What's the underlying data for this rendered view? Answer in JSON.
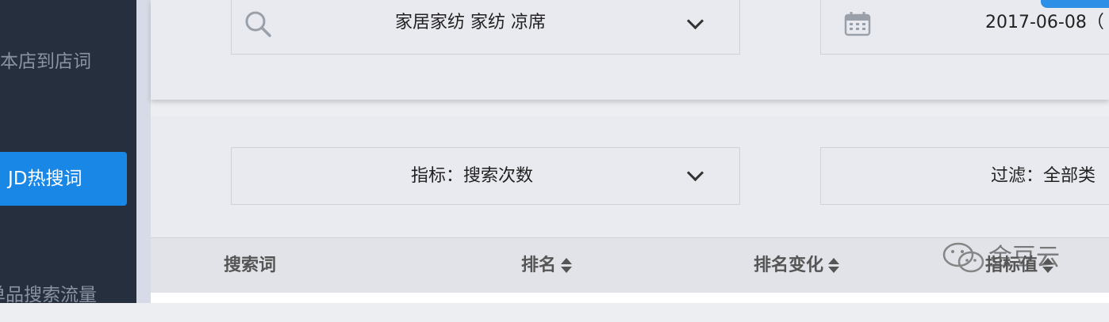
{
  "sidebar": {
    "items": [
      {
        "label": "本店到店词"
      },
      {
        "label": "JD热搜词"
      },
      {
        "label": "单品搜索流量"
      }
    ]
  },
  "top_panel": {
    "category_select": {
      "value": "家居家纺 家纺 凉席"
    },
    "date_field": {
      "value": "2017-06-08（"
    }
  },
  "mid_panel": {
    "metric_select": {
      "value": "指标：搜索次数"
    },
    "filter_select": {
      "value": "过滤：全部类"
    }
  },
  "table": {
    "headers": [
      "搜索词",
      "排名",
      "排名变化",
      "指标值"
    ]
  },
  "watermark": {
    "text": "金豆云"
  },
  "colors": {
    "sidebar_bg": "#262f3e",
    "active_item": "#1987e6",
    "panel_bg": "#eaebf0"
  }
}
